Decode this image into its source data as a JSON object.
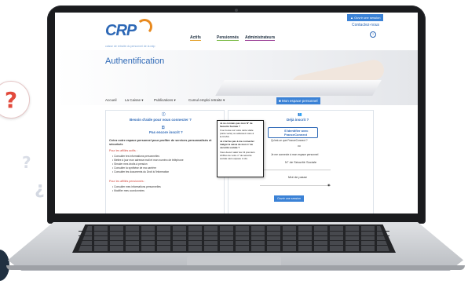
{
  "decor": {
    "badge_glyph": "?",
    "faded_glyph_1": "?",
    "faded_glyph_2": "¿"
  },
  "site": {
    "logo": "CRP",
    "tagline": "caisse de retraite du personnel de la ratp",
    "nav": [
      "Actifs",
      "Pensionnés",
      "Administrateurs"
    ],
    "open_session": "▲ Ouvrir une session",
    "contact": "Contactez-nous",
    "help_glyph": "?",
    "page_title": "Authentification"
  },
  "menu": {
    "items": [
      "Accueil",
      "La Caisse ▾",
      "Publications ▾",
      "Cumul emploi retraite ▾"
    ],
    "active": "■ Mon espace personnel"
  },
  "left_col": {
    "help_icon": "ⓘ",
    "help_title": "Besoin d'aide pour vous connecter ?",
    "key_icon": "⚿",
    "not_registered": "Pas encore inscrit ?",
    "create_title": "Créez votre espace personnel pour profiter de services personnalisés et sécurisés",
    "actifs_heading": "Pour les affiliés actifs :",
    "actifs_items": [
      "Consulter tes informations personnelles",
      "Mettre à jour mon adresse mail et mon numéro de téléphone",
      "Simuler mes droits à pension",
      "Consulter la synthèse de ma carrière",
      "Consulter les documents du Droit à l'information"
    ],
    "pens_heading": "Pour les affiliés pensionnés :",
    "pens_items": [
      "Consulter mes informations personnelles",
      "Modifier mes coordonnées"
    ]
  },
  "right_col": {
    "users_icon": "👥",
    "title": "Déjà inscrit ?",
    "franceconnect": "S'identifier avec FranceConnect",
    "fc_question": "Qu'est-ce que FranceConnect ?",
    "ou": "ou",
    "connect_label": "Je me connecte à mon espace personnel",
    "ssn_label": "N° de Sécurité Sociale",
    "password_label": "Mot de passe",
    "eye_icon": "◉",
    "submit": "Ouvrir une session"
  },
  "tooltip": {
    "lines": [
      "Je ne connais pas mon N° de",
      "Sécurité Sociale ?",
      "Il se trouve sur votre carte vitale",
      "(carte verte) ou adressez-vous à",
      "la CCAS.",
      "Je n'arrive pas à me connecter",
      "malgré la saisie de mon n° de",
      "sécurité sociale ?",
      "Vous devez saisir les 13 premiers",
      "chiffres de votre n° de sécurité",
      "sociale sans espace ni clé."
    ]
  }
}
